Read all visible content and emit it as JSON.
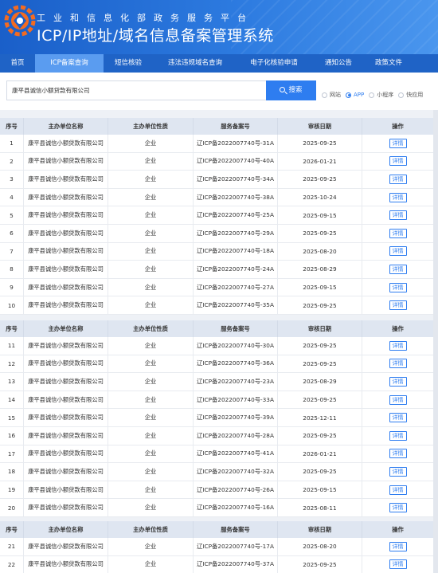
{
  "header": {
    "subtitle": "工业和信息化部政务服务平台",
    "title": "ICP/IP地址/域名信息备案管理系统"
  },
  "nav": {
    "items": [
      {
        "label": "首页",
        "active": false
      },
      {
        "label": "ICP备案查询",
        "active": true
      },
      {
        "label": "短信核验",
        "active": false
      },
      {
        "label": "违法违规域名查询",
        "active": false
      },
      {
        "label": "电子化核验申请",
        "active": false
      },
      {
        "label": "通知公告",
        "active": false
      },
      {
        "label": "政策文件",
        "active": false
      }
    ]
  },
  "search": {
    "value": "康平县诚信小额贷款有限公司",
    "button_label": "搜索",
    "radios": [
      {
        "label": "网站",
        "checked": false
      },
      {
        "label": "APP",
        "checked": true
      },
      {
        "label": "小程序",
        "checked": false
      },
      {
        "label": "快应用",
        "checked": false
      }
    ]
  },
  "table": {
    "headers": [
      "序号",
      "主办单位名称",
      "主办单位性质",
      "服务备案号",
      "审核日期",
      "操作"
    ],
    "action_label": "详情",
    "groups": [
      [
        [
          "1",
          "康平县诚信小额贷款有限公司",
          "企业",
          "辽ICP备2022007740号-31A",
          "2025-09-25"
        ],
        [
          "2",
          "康平县诚信小额贷款有限公司",
          "企业",
          "辽ICP备2022007740号-40A",
          "2026-01-21"
        ],
        [
          "3",
          "康平县诚信小额贷款有限公司",
          "企业",
          "辽ICP备2022007740号-34A",
          "2025-09-25"
        ],
        [
          "4",
          "康平县诚信小额贷款有限公司",
          "企业",
          "辽ICP备2022007740号-38A",
          "2025-10-24"
        ],
        [
          "5",
          "康平县诚信小额贷款有限公司",
          "企业",
          "辽ICP备2022007740号-25A",
          "2025-09-15"
        ],
        [
          "6",
          "康平县诚信小额贷款有限公司",
          "企业",
          "辽ICP备2022007740号-29A",
          "2025-09-25"
        ],
        [
          "7",
          "康平县诚信小额贷款有限公司",
          "企业",
          "辽ICP备2022007740号-18A",
          "2025-08-20"
        ],
        [
          "8",
          "康平县诚信小额贷款有限公司",
          "企业",
          "辽ICP备2022007740号-24A",
          "2025-08-29"
        ],
        [
          "9",
          "康平县诚信小额贷款有限公司",
          "企业",
          "辽ICP备2022007740号-27A",
          "2025-09-15"
        ],
        [
          "10",
          "康平县诚信小额贷款有限公司",
          "企业",
          "辽ICP备2022007740号-35A",
          "2025-09-25"
        ]
      ],
      [
        [
          "11",
          "康平县诚信小额贷款有限公司",
          "企业",
          "辽ICP备2022007740号-30A",
          "2025-09-25"
        ],
        [
          "12",
          "康平县诚信小额贷款有限公司",
          "企业",
          "辽ICP备2022007740号-36A",
          "2025-09-25"
        ],
        [
          "13",
          "康平县诚信小额贷款有限公司",
          "企业",
          "辽ICP备2022007740号-23A",
          "2025-08-29"
        ],
        [
          "14",
          "康平县诚信小额贷款有限公司",
          "企业",
          "辽ICP备2022007740号-33A",
          "2025-09-25"
        ],
        [
          "15",
          "康平县诚信小额贷款有限公司",
          "企业",
          "辽ICP备2022007740号-39A",
          "2025-12-11"
        ],
        [
          "16",
          "康平县诚信小额贷款有限公司",
          "企业",
          "辽ICP备2022007740号-28A",
          "2025-09-25"
        ],
        [
          "17",
          "康平县诚信小额贷款有限公司",
          "企业",
          "辽ICP备2022007740号-41A",
          "2026-01-21"
        ],
        [
          "18",
          "康平县诚信小额贷款有限公司",
          "企业",
          "辽ICP备2022007740号-32A",
          "2025-09-25"
        ],
        [
          "19",
          "康平县诚信小额贷款有限公司",
          "企业",
          "辽ICP备2022007740号-26A",
          "2025-09-15"
        ],
        [
          "20",
          "康平县诚信小额贷款有限公司",
          "企业",
          "辽ICP备2022007740号-16A",
          "2025-08-11"
        ]
      ],
      [
        [
          "21",
          "康平县诚信小额贷款有限公司",
          "企业",
          "辽ICP备2022007740号-17A",
          "2025-08-20"
        ],
        [
          "22",
          "康平县诚信小额贷款有限公司",
          "企业",
          "辽ICP备2022007740号-37A",
          "2025-09-25"
        ]
      ]
    ]
  },
  "colors": {
    "primary": "#2e7df0",
    "nav_bg": "#1f63c6",
    "nav_active": "#5a9cf0",
    "table_header_bg": "#dfe6f1",
    "page_bg": "#eef1f6"
  }
}
